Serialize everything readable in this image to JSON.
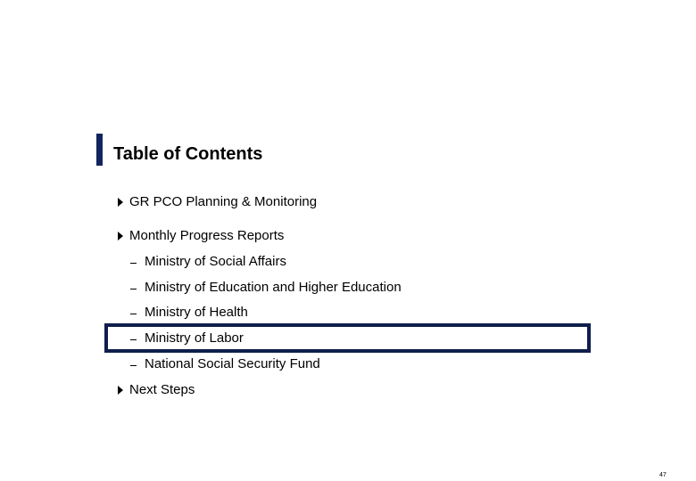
{
  "slide": {
    "title": "Table of Contents",
    "accent_color": "#12245e",
    "highlight_color": "#0f1e4c",
    "items": [
      {
        "label": "GR PCO Planning & Monitoring",
        "level": 1,
        "bullet": "triangle-right-icon"
      },
      {
        "label": "Monthly Progress Reports",
        "level": 1,
        "bullet": "triangle-right-icon",
        "subitems": [
          {
            "label": "Ministry of Social Affairs",
            "level": 2,
            "bullet": "dash-icon"
          },
          {
            "label": "Ministry of Education and Higher Education",
            "level": 2,
            "bullet": "dash-icon"
          },
          {
            "label": "Ministry of Health",
            "level": 2,
            "bullet": "dash-icon"
          },
          {
            "label": "Ministry of Labor",
            "level": 2,
            "bullet": "dash-icon",
            "highlighted": true
          },
          {
            "label": "National Social Security Fund",
            "level": 2,
            "bullet": "dash-icon"
          }
        ]
      },
      {
        "label": "Next Steps",
        "level": 1,
        "bullet": "triangle-right-icon"
      }
    ],
    "page_number": "47"
  }
}
